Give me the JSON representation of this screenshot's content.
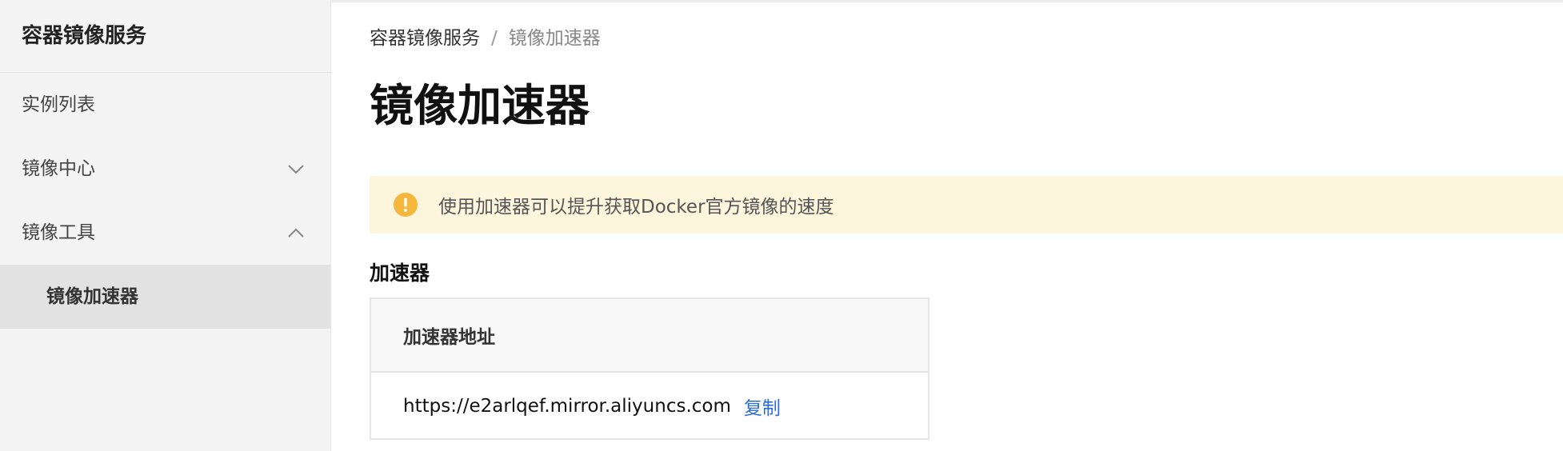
{
  "sidebar": {
    "title": "容器镜像服务",
    "items": [
      {
        "label": "实例列表"
      },
      {
        "label": "镜像中心",
        "icon": "chevron-down-icon"
      },
      {
        "label": "镜像工具",
        "icon": "chevron-up-icon"
      }
    ],
    "sub_items": [
      {
        "label": "镜像加速器",
        "selected": true
      }
    ]
  },
  "breadcrumb": {
    "root": "容器镜像服务",
    "separator": "/",
    "current": "镜像加速器"
  },
  "page": {
    "title": "镜像加速器"
  },
  "notice": {
    "icon": "warning-icon",
    "text": "使用加速器可以提升获取Docker官方镜像的速度"
  },
  "accelerator": {
    "section_title": "加速器",
    "column_header": "加速器地址",
    "address": "https://e2arlqef.mirror.aliyuncs.com",
    "copy_label": "复制"
  },
  "colors": {
    "sidebar_bg": "#f4f4f4",
    "selected_bg": "#e2e2e2",
    "notice_bg": "#fdf5dc",
    "warning": "#f5b83d",
    "link": "#2a6fd6"
  }
}
